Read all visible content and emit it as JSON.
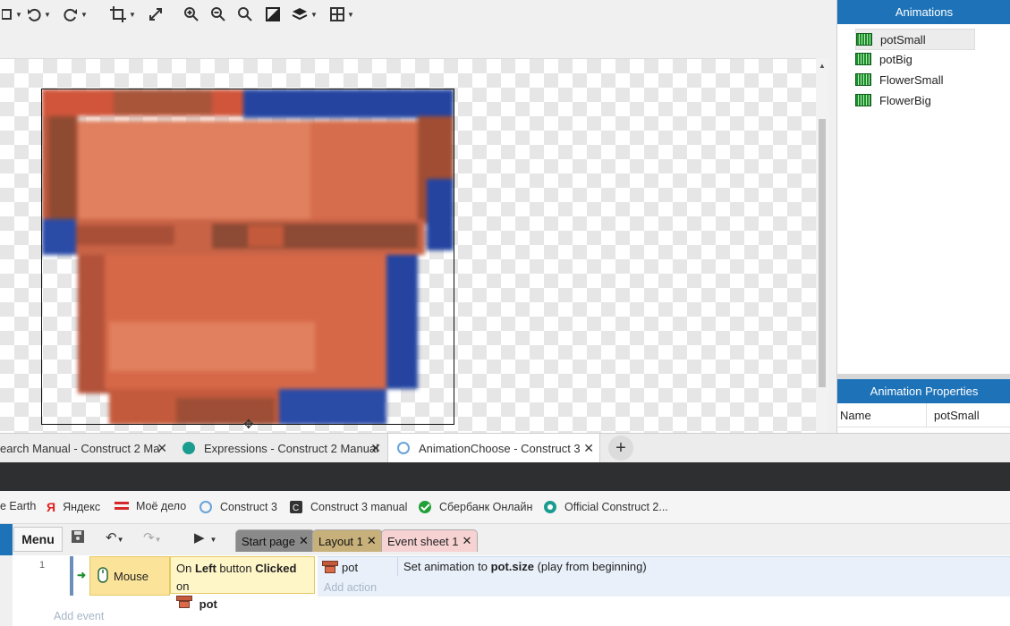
{
  "toolbar": {
    "icons": [
      "select-dropdown-icon",
      "rotate-ccw-icon",
      "rotate-cw-icon",
      "crop-icon",
      "resize-icon",
      "zoom-in-icon",
      "zoom-out-icon",
      "zoom-reset-icon",
      "color-icon",
      "layers-icon",
      "grid-icon"
    ]
  },
  "animations_panel": {
    "title": "Animations",
    "items": [
      "potSmall",
      "potBig",
      "FlowerSmall",
      "FlowerBig"
    ],
    "selected": "potSmall"
  },
  "properties_panel": {
    "title": "Animation Properties",
    "rows": [
      {
        "name": "Name",
        "value": "potSmall"
      }
    ]
  },
  "browser_tabs": [
    {
      "label": "earch Manual - Construct 2 Ma"
    },
    {
      "label": "Expressions - Construct 2 Manual"
    },
    {
      "label": "AnimationChoose - Construct 3",
      "active": true
    }
  ],
  "bookmarks": [
    "e Earth",
    "Яндекс",
    "Моё дело",
    "Construct 3",
    "Construct 3 manual",
    "Сбербанк Онлайн",
    "Official Construct 2..."
  ],
  "c3": {
    "menu_label": "Menu",
    "tabs": [
      {
        "label": "Start page"
      },
      {
        "label": "Layout 1"
      },
      {
        "label": "Event sheet 1",
        "active": true
      }
    ],
    "event": {
      "number": "1",
      "condition_object": "Mouse",
      "condition_prefix": "On ",
      "condition_bold1": "Left",
      "condition_mid": " button ",
      "condition_bold2": "Clicked",
      "condition_suffix": " on",
      "condition_target": "pot",
      "action_object": "pot",
      "action_prefix": "Set animation to ",
      "action_bold": "pot.size",
      "action_suffix": " (play from beginning)",
      "add_action": "Add action"
    },
    "add_event": "Add event"
  },
  "colors": {
    "accent": "#1e73b8",
    "condition_bg": "#fff6c8",
    "action_bg": "#e9f0fa"
  }
}
